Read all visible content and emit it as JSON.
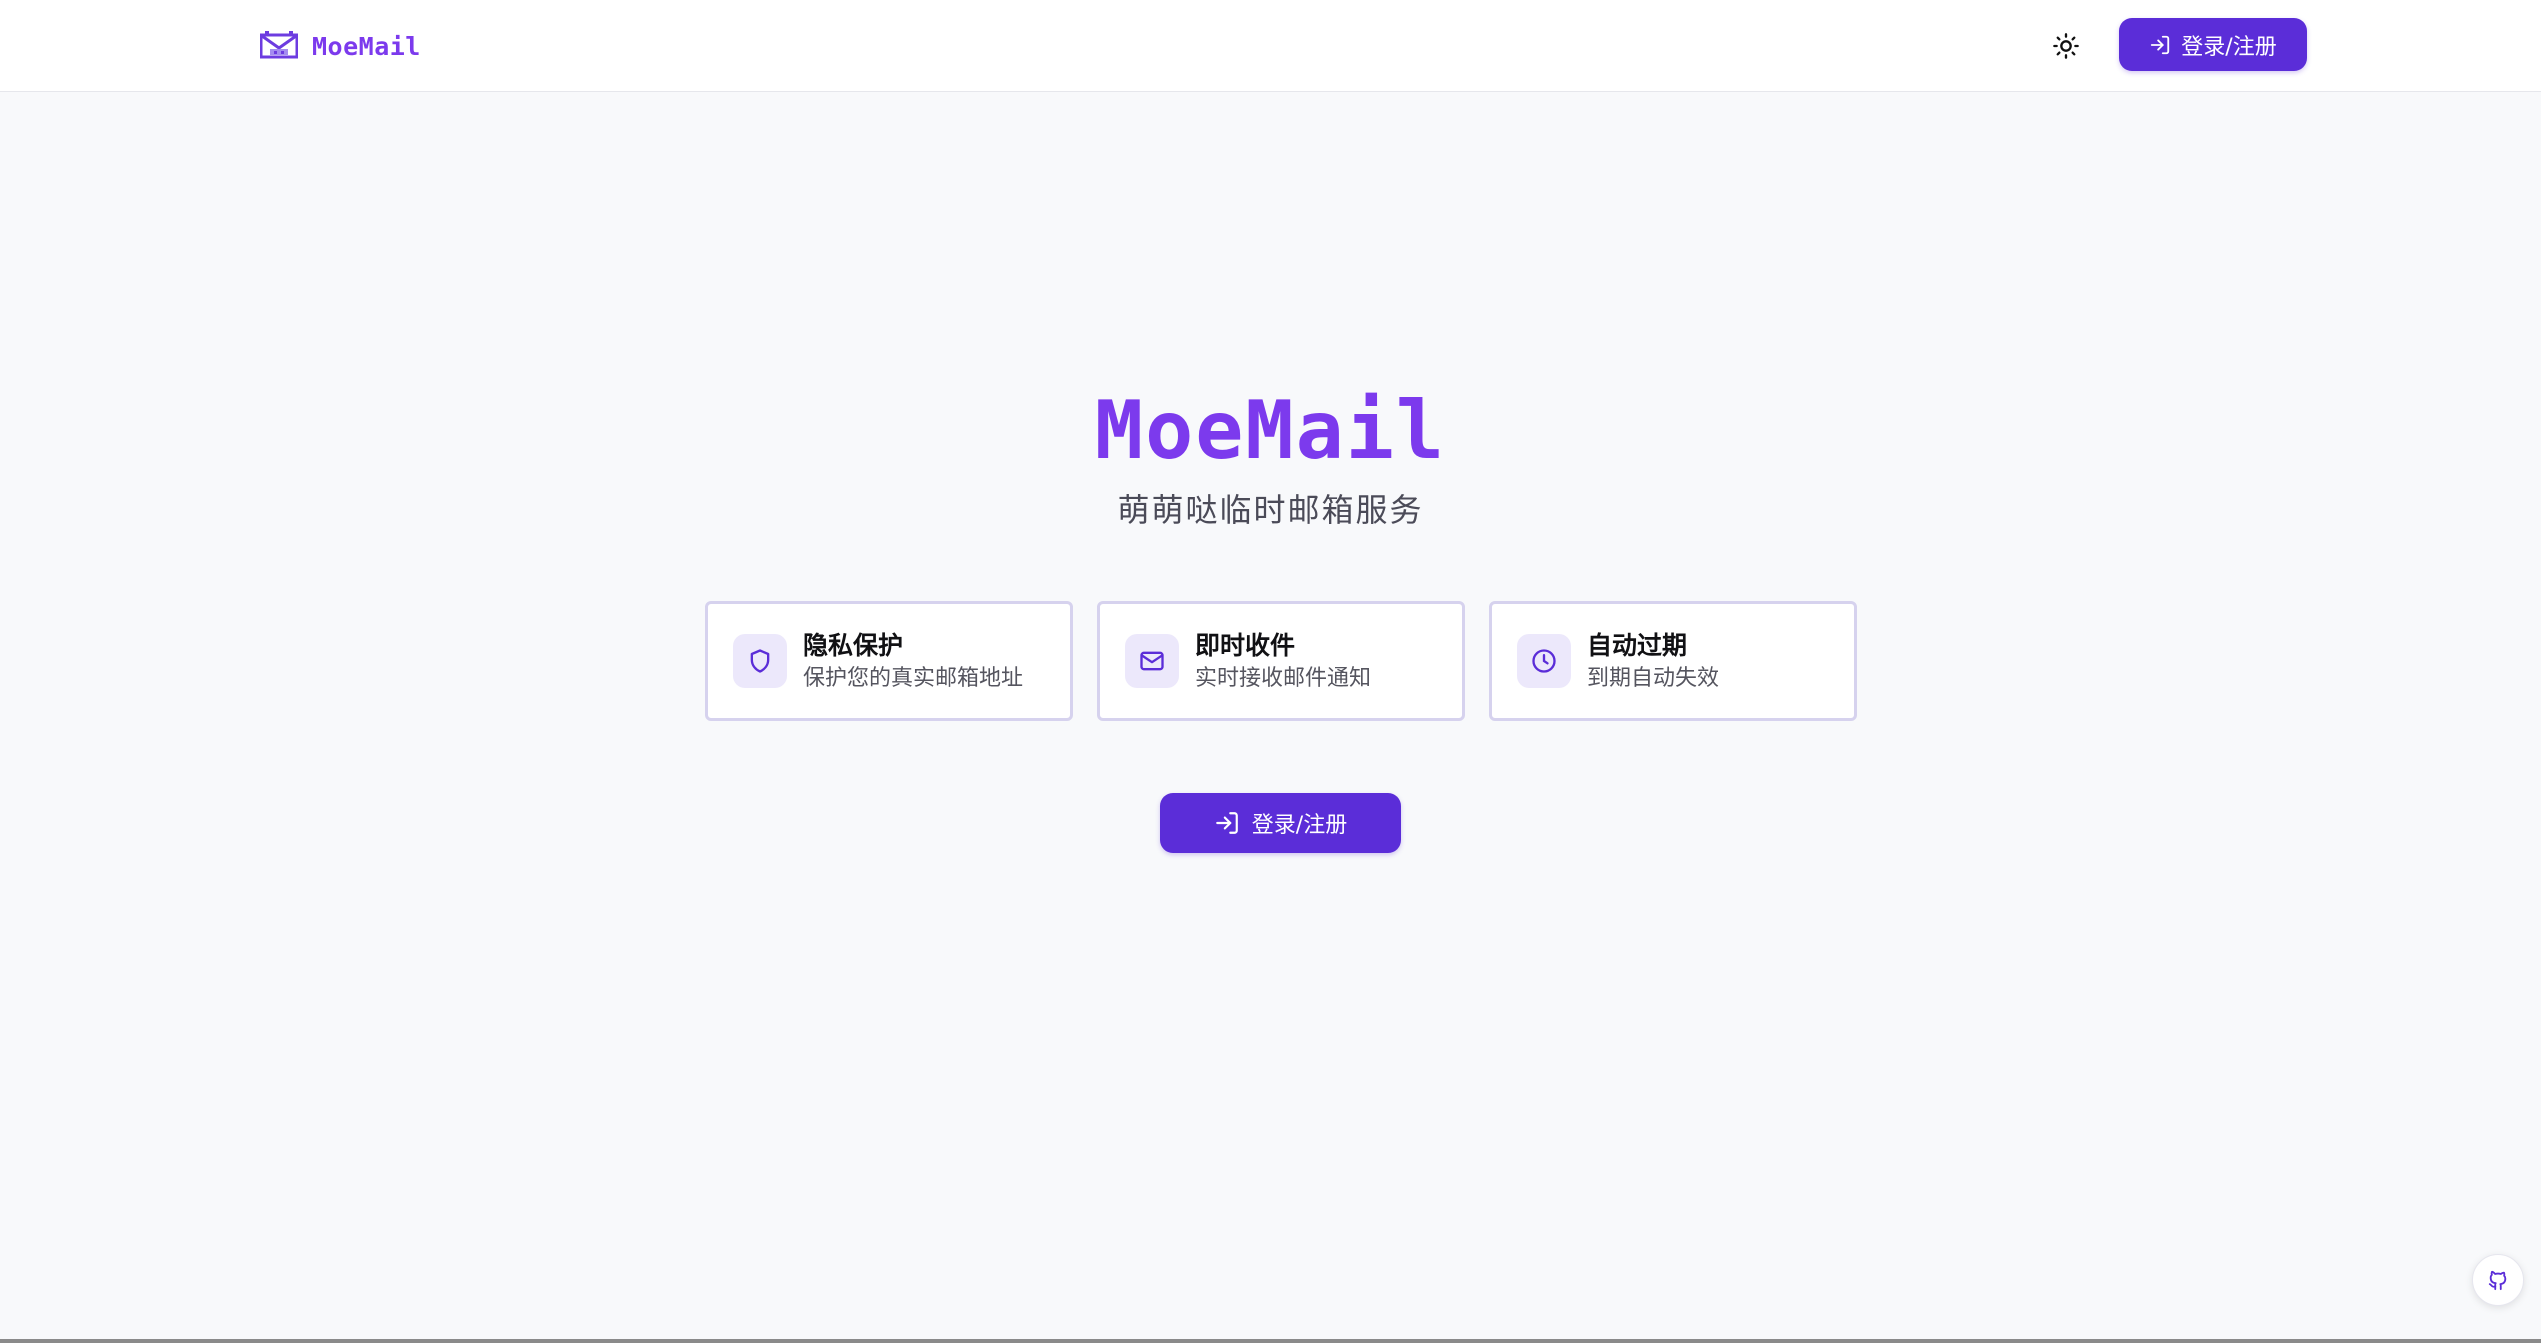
{
  "header": {
    "logo_text": "MoeMail",
    "theme_icon": "sun-icon",
    "login_label": "登录/注册",
    "login_icon": "log-in-icon"
  },
  "hero": {
    "title": "MoeMail",
    "subtitle": "萌萌哒临时邮箱服务"
  },
  "features": [
    {
      "icon": "shield-icon",
      "title": "隐私保护",
      "description": "保护您的真实邮箱地址"
    },
    {
      "icon": "mail-icon",
      "title": "即时收件",
      "description": "实时接收邮件通知"
    },
    {
      "icon": "clock-icon",
      "title": "自动过期",
      "description": "到期自动失效"
    }
  ],
  "main": {
    "login_label": "登录/注册",
    "login_icon": "log-in-icon"
  },
  "floating": {
    "github_icon": "github-icon"
  },
  "colors": {
    "brand": "#7c3aed",
    "primary_button": "#5b2dd8",
    "icon_background": "#ece8fb",
    "card_border": "#d6d2ee"
  }
}
